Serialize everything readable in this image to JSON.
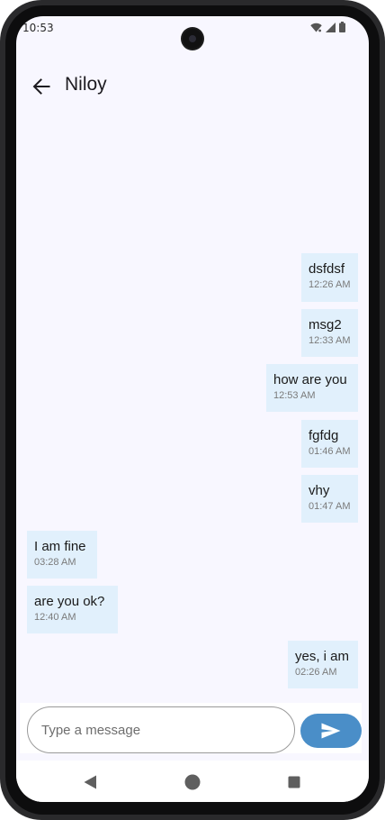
{
  "status_bar": {
    "time": "10:53",
    "icons": [
      "wifi-icon",
      "signal-icon",
      "battery-icon"
    ]
  },
  "app_bar": {
    "back_icon": "arrow-left-icon",
    "title": "Niloy"
  },
  "messages": [
    {
      "text": "dsfdsf",
      "time": "12:26 AM",
      "side": "right"
    },
    {
      "text": "msg2",
      "time": "12:33 AM",
      "side": "right"
    },
    {
      "text": "how are you",
      "time": "12:53 AM",
      "side": "right"
    },
    {
      "text": "fgfdg",
      "time": "01:46 AM",
      "side": "right"
    },
    {
      "text": "vhy",
      "time": "01:47 AM",
      "side": "right"
    },
    {
      "text": "I am fine",
      "time": "03:28 AM",
      "side": "left"
    },
    {
      "text": "are you ok?",
      "time": "12:40 AM",
      "side": "left"
    },
    {
      "text": "yes, i am",
      "time": "02:26 AM",
      "side": "right"
    }
  ],
  "composer": {
    "placeholder": "Type a message",
    "value": "",
    "send_icon": "send-icon"
  },
  "nav_bar": {
    "icons": [
      "nav-back-icon",
      "nav-home-icon",
      "nav-recents-icon"
    ]
  },
  "colors": {
    "bubble": "#e1f0fc",
    "send_button": "#4a8ec8",
    "screen_background": "#f8f7ff"
  }
}
